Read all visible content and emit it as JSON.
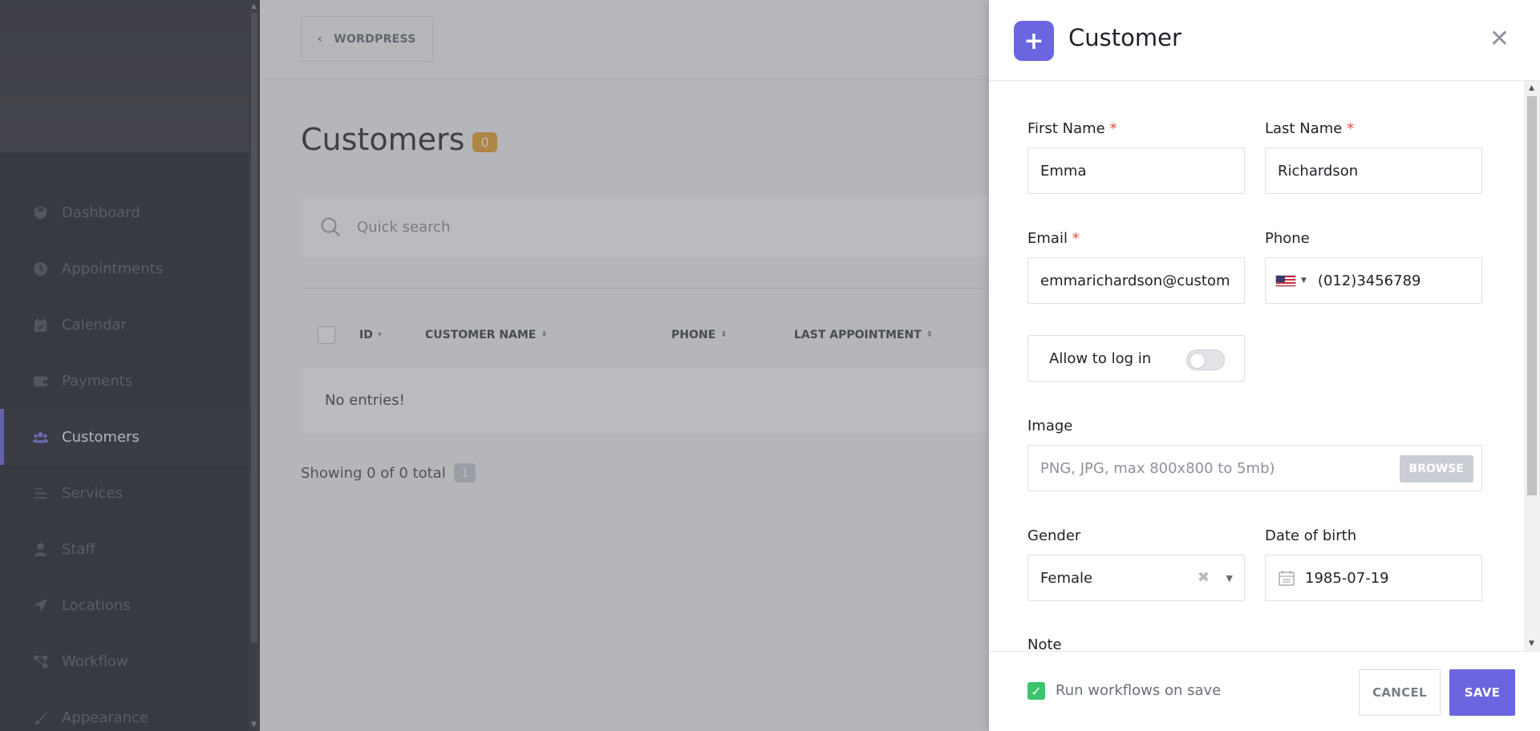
{
  "sidebar": {
    "items": [
      {
        "label": "Dashboard",
        "icon": "cube-icon"
      },
      {
        "label": "Appointments",
        "icon": "clock-icon"
      },
      {
        "label": "Calendar",
        "icon": "calendar-check-icon"
      },
      {
        "label": "Payments",
        "icon": "wallet-icon"
      },
      {
        "label": "Customers",
        "icon": "users-icon",
        "active": true
      },
      {
        "label": "Services",
        "icon": "list-icon"
      },
      {
        "label": "Staff",
        "icon": "user-icon"
      },
      {
        "label": "Locations",
        "icon": "location-arrow-icon"
      },
      {
        "label": "Workflow",
        "icon": "workflow-icon"
      },
      {
        "label": "Appearance",
        "icon": "brush-icon"
      }
    ]
  },
  "topbar": {
    "back_label": "WORDPRESS"
  },
  "page": {
    "title": "Customers",
    "count": "0",
    "search_placeholder": "Quick search"
  },
  "table": {
    "columns": [
      "ID",
      "CUSTOMER NAME",
      "PHONE",
      "LAST APPOINTMENT"
    ],
    "empty_text": "No entries!",
    "showing_text": "Showing 0 of 0 total",
    "page_number": "1"
  },
  "panel": {
    "title": "Customer",
    "first_name": {
      "label": "First Name",
      "required": "*",
      "value": "Emma"
    },
    "last_name": {
      "label": "Last Name",
      "required": "*",
      "value": "Richardson"
    },
    "email": {
      "label": "Email",
      "required": "*",
      "value": "emmarichardson@custom"
    },
    "phone": {
      "label": "Phone",
      "value": "(012)3456789"
    },
    "allow_login": {
      "label": "Allow to log in",
      "enabled": false
    },
    "image": {
      "label": "Image",
      "placeholder": "PNG, JPG, max 800x800 to 5mb)",
      "browse_label": "BROWSE"
    },
    "gender": {
      "label": "Gender",
      "value": "Female"
    },
    "dob": {
      "label": "Date of birth",
      "value": "1985-07-19"
    },
    "note": {
      "label": "Note"
    }
  },
  "footer": {
    "run_workflows_label": "Run workflows on save",
    "run_workflows_checked": true,
    "cancel_label": "CANCEL",
    "save_label": "SAVE"
  },
  "colors": {
    "accent": "#6b66df",
    "badge": "#e8a22f",
    "success": "#3bc46b",
    "sidebar_bg": "#1f2128"
  }
}
